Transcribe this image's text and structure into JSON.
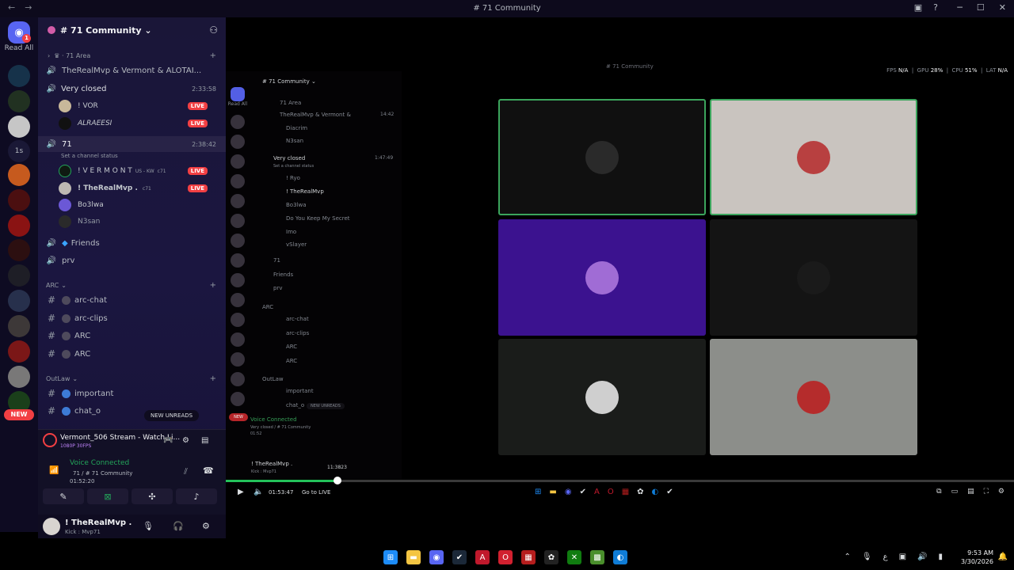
{
  "window": {
    "title": "# 71 Community",
    "back": "←",
    "forward": "→"
  },
  "rail": {
    "read_all": "Read All",
    "home_badge": "1",
    "count_label": "1s",
    "new_pill": "NEW"
  },
  "server": {
    "name": "# 71 Community ⌄"
  },
  "sidebar": {
    "category_71": "71 Area",
    "channel_1": "TheRealMvp & Vermont & ALOTAI...",
    "channel_very_closed": "Very closed",
    "very_closed_time": "2:33:58",
    "users_vc": [
      {
        "name": "! VOR",
        "live": "LIVE"
      },
      {
        "name": "ALRAEESI",
        "live": "LIVE"
      }
    ],
    "channel_71": "71",
    "channel_71_time": "2:38:42",
    "channel_71_status": "Set a channel status",
    "users_71": [
      {
        "name": "! V E R M O N T",
        "tag": "US - KW",
        "clan": "c71",
        "live": "LIVE"
      },
      {
        "name": "! TheRealMvp .",
        "tag": "",
        "clan": "c71",
        "live": "LIVE"
      },
      {
        "name": "Bo3lwa",
        "tag": "",
        "clan": "",
        "live": ""
      },
      {
        "name": "N3san",
        "tag": "",
        "clan": "",
        "live": ""
      }
    ],
    "channel_friends": "Friends",
    "channel_prv": "prv",
    "category_arc": "ARC",
    "arc_channels": [
      "arc-chat",
      "arc-clips",
      "ARC",
      "ARC"
    ],
    "category_outlaw": "OutLaw",
    "outlaw_channels": [
      "important",
      "chat_o"
    ],
    "new_unreads": "NEW UNREADS"
  },
  "panel": {
    "stream_title": "Vermont_506 Stream - Watch Li...",
    "stream_quality": "1080P 30FPS",
    "voice_connected": "Voice Connected",
    "voice_channel": "71 / # 71 Community",
    "voice_time": "01:52:20"
  },
  "user": {
    "name": "! TheRealMvp .",
    "status": "Kick : Mvp71"
  },
  "player": {
    "inner_title": "# 71 Community",
    "hud": {
      "fps": "N/A",
      "gpu": "28%",
      "cpu": "51%",
      "lat": "N/A"
    },
    "time": "01:53:47",
    "go_live": "Go to LIVE",
    "tiles": [
      {
        "bg": "#101010",
        "border": "#3ba55c",
        "face": "#2a2a2a"
      },
      {
        "bg": "#c9c4bf",
        "border": "#3ba55c",
        "face": "#b84040"
      },
      {
        "bg": "#3b128f",
        "border": "",
        "face": "#a06cd5"
      },
      {
        "bg": "#141414",
        "border": "",
        "face": "#1a1a1a"
      },
      {
        "bg": "#1a1c1a",
        "border": "",
        "face": "#cfcfcf"
      },
      {
        "bg": "#8c8e8a",
        "border": "",
        "face": "#b52c2c"
      }
    ],
    "progress": 0.142,
    "inner": {
      "server": "# 71 Community ⌄",
      "read_all": "Read All",
      "category_71": "71 Area",
      "rows": [
        "TheRealMvp & Vermont &",
        "Diacrim",
        "N3san",
        "Very closed",
        "Set a channel status",
        "! Ryo",
        "! TheRealMvp",
        "Bo3lwa",
        "Do You Keep My Secret",
        "Imo",
        "vSlayer",
        "71",
        "Friends",
        "prv",
        "ARC",
        "arc-chat",
        "arc-clips",
        "ARC",
        "ARC",
        "OutLaw",
        "important",
        "chat_o"
      ],
      "very_closed_time": "1:47:49",
      "channel_time": "14:42",
      "voice_connected": "Voice Connected",
      "voice_channel": "Very closed / # 71 Community",
      "voice_time": "01:52",
      "user_name": "! TheRealMvp .",
      "user_status": "Kick : Mvp71",
      "user_time": "11:3823",
      "new_unreads": "NEW UNREADS",
      "new_pill": "NEW"
    }
  },
  "taskbar": {
    "time": "9:53 AM",
    "date": "3/30/2026",
    "apps": [
      {
        "icon": "windows-icon",
        "color": "#1d8cf8"
      },
      {
        "icon": "files-icon",
        "color": "#f4c542"
      },
      {
        "icon": "discord-icon",
        "color": "#5865f2"
      },
      {
        "icon": "steam-icon",
        "color": "#1b2838"
      },
      {
        "icon": "adobe-icon",
        "color": "#c0192c"
      },
      {
        "icon": "opera-icon",
        "color": "#d1202f"
      },
      {
        "icon": "media-icon",
        "color": "#b51d1d"
      },
      {
        "icon": "chatgpt-icon",
        "color": "#222"
      },
      {
        "icon": "xbox-icon",
        "color": "#107c10"
      },
      {
        "icon": "minecraft-icon",
        "color": "#4a8f2c"
      },
      {
        "icon": "edge-icon",
        "color": "#0f7cd6"
      }
    ]
  }
}
